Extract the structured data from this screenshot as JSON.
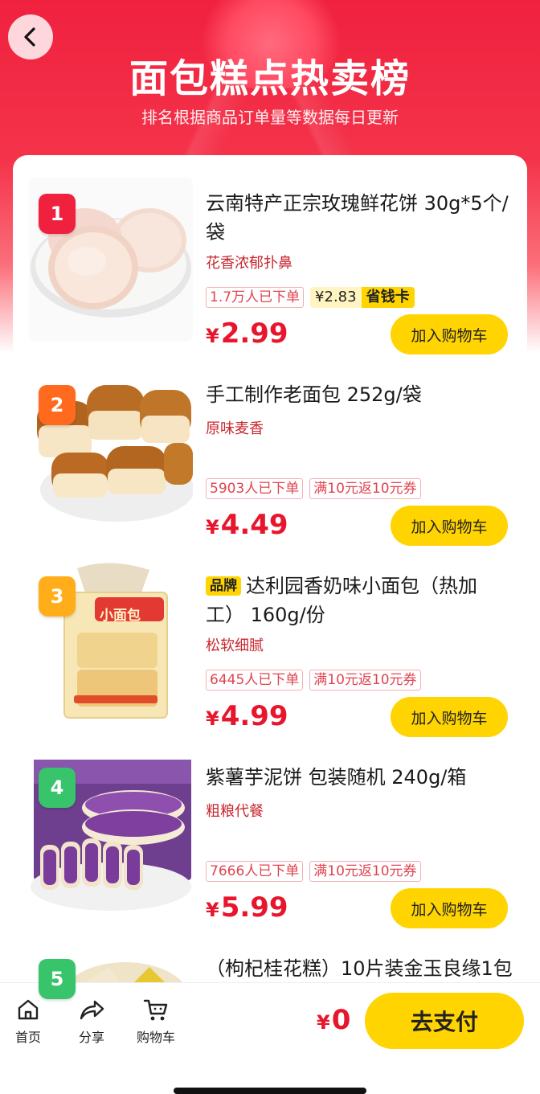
{
  "header": {
    "title": "面包糕点热卖榜",
    "subtitle": "排名根据商品订单量等数据每日更新"
  },
  "colors": {
    "brand_red": "#f0213f",
    "price_red": "#e8162c",
    "button_yellow": "#ffd400",
    "rank_1": "#f0213f",
    "rank_2": "#ff6a1e",
    "rank_3": "#ffae1a",
    "rank_4": "#37c46b",
    "rank_5": "#37c46b"
  },
  "cart_button_label": "加入购物车",
  "items": [
    {
      "rank": "1",
      "name": "云南特产正宗玫瑰鲜花饼 30g*5个/袋",
      "brand_tag": "",
      "tagline": "花香浓郁扑鼻",
      "orders": "1.7万人已下单",
      "card_price": "¥2.83",
      "card_label": "省钱卡",
      "coupon": "",
      "currency": "¥",
      "price": "2.99",
      "image": "flower-pastry"
    },
    {
      "rank": "2",
      "name": "手工制作老面包 252g/袋",
      "brand_tag": "",
      "tagline": "原味麦香",
      "orders": "5903人已下单",
      "coupon": "满10元返10元券",
      "currency": "¥",
      "price": "4.49",
      "image": "bread-rolls"
    },
    {
      "rank": "3",
      "name": "达利园香奶味小面包（热加工） 160g/份",
      "brand_tag": "品牌",
      "tagline": "松软细腻",
      "orders": "6445人已下单",
      "coupon": "满10元返10元券",
      "currency": "¥",
      "price": "4.99",
      "image": "packaged-bread",
      "package_text": "小面包"
    },
    {
      "rank": "4",
      "name": "紫薯芋泥饼 包装随机 240g/箱",
      "brand_tag": "",
      "tagline": "粗粮代餐",
      "orders": "7666人已下单",
      "coupon": "满10元返10元券",
      "currency": "¥",
      "price": "5.99",
      "image": "purple-yam-cake"
    },
    {
      "rank": "5",
      "name": "（枸杞桂花糕）10片装金玉良缘1包",
      "image": "osmanthus-cake"
    }
  ],
  "bottom_nav": {
    "home": "首页",
    "share": "分享",
    "cart": "购物车",
    "total_currency": "¥",
    "total_value": "0",
    "pay_label": "去支付"
  }
}
